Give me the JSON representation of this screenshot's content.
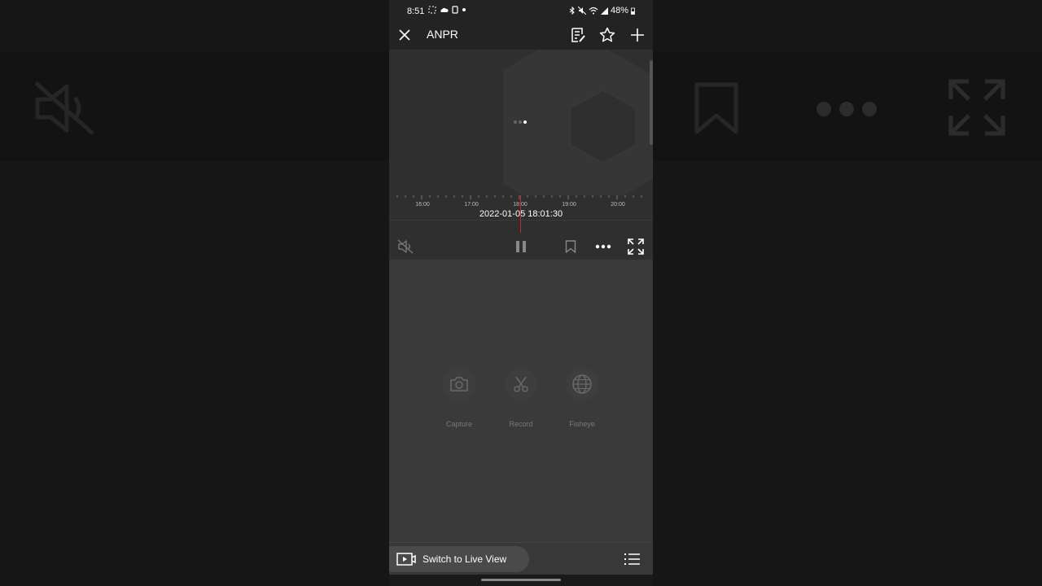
{
  "status_bar": {
    "time": "8:51",
    "battery": "48%"
  },
  "app_bar": {
    "title": "ANPR"
  },
  "timeline": {
    "ticks": [
      "16:00",
      "17:00",
      "18:00",
      "19:00",
      "20:00"
    ],
    "timestamp": "2022-01-05 18:01:30"
  },
  "tools": {
    "capture": "Capture",
    "record": "Record",
    "fisheye": "Fisheye"
  },
  "bottom": {
    "live_view_label": "Switch to Live View"
  },
  "colors": {
    "accent_cursor": "#c0282f",
    "background": "#3a3a3a",
    "bar": "#232323"
  }
}
